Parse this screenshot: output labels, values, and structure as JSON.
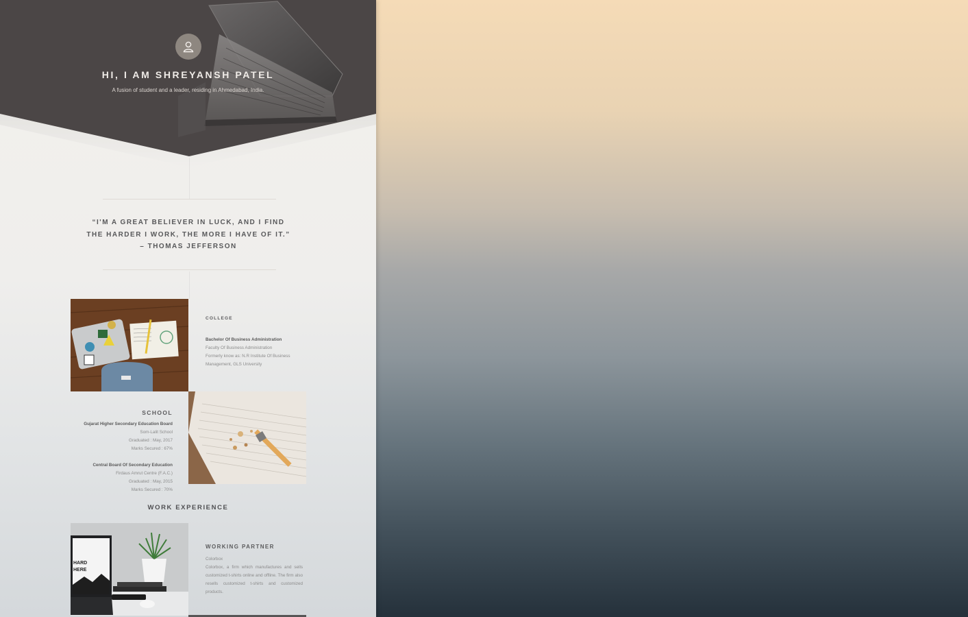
{
  "hero": {
    "title": "HI, I AM SHREYANSH PATEL",
    "subtitle": "A fusion of student and a leader, residing in Ahmedabad, India.",
    "avatar_icon": "user-icon"
  },
  "quote": {
    "line1": "“I'M A GREAT BELIEVER IN LUCK, AND I FIND",
    "line2": "THE HARDER I WORK, THE MORE I HAVE OF IT.”",
    "author": "– THOMAS JEFFERSON"
  },
  "college": {
    "heading": "COLLEGE",
    "degree": "Bachelor Of Business Administration",
    "faculty": "Faculty Of Business Administration",
    "formerly_1": "Formerly know as: N.R Institute Of Business",
    "formerly_2": "Management, GLS University"
  },
  "school": {
    "heading": "SCHOOL",
    "board1": "Gujarat Higher Secondary Education Board",
    "school1": "Som-Lalit School",
    "grad1": "Graduated : May, 2017",
    "marks1": "Marks Secured : 67%",
    "board2": "Central Board Of Secondary Education",
    "school2": "Firdaus Amrut Centre (F.A.C.)",
    "grad2": "Graduated : May, 2015",
    "marks2": "Marks Secured : 70%"
  },
  "work": {
    "section_title": "WORK EXPERIENCE",
    "heading": "WORKING PARTNER",
    "company": "Colorbox",
    "description": "Colorbox, a firm which manufactures and sells customized t-shirts online and offline. The firm also resells customized t-shirts and customized products."
  },
  "laptop_screen_text": "HARD\nHERE",
  "colors": {
    "hero_bg": "#4b4646",
    "panel_bg": "#f3f1ed",
    "text_dark": "#58585a"
  }
}
